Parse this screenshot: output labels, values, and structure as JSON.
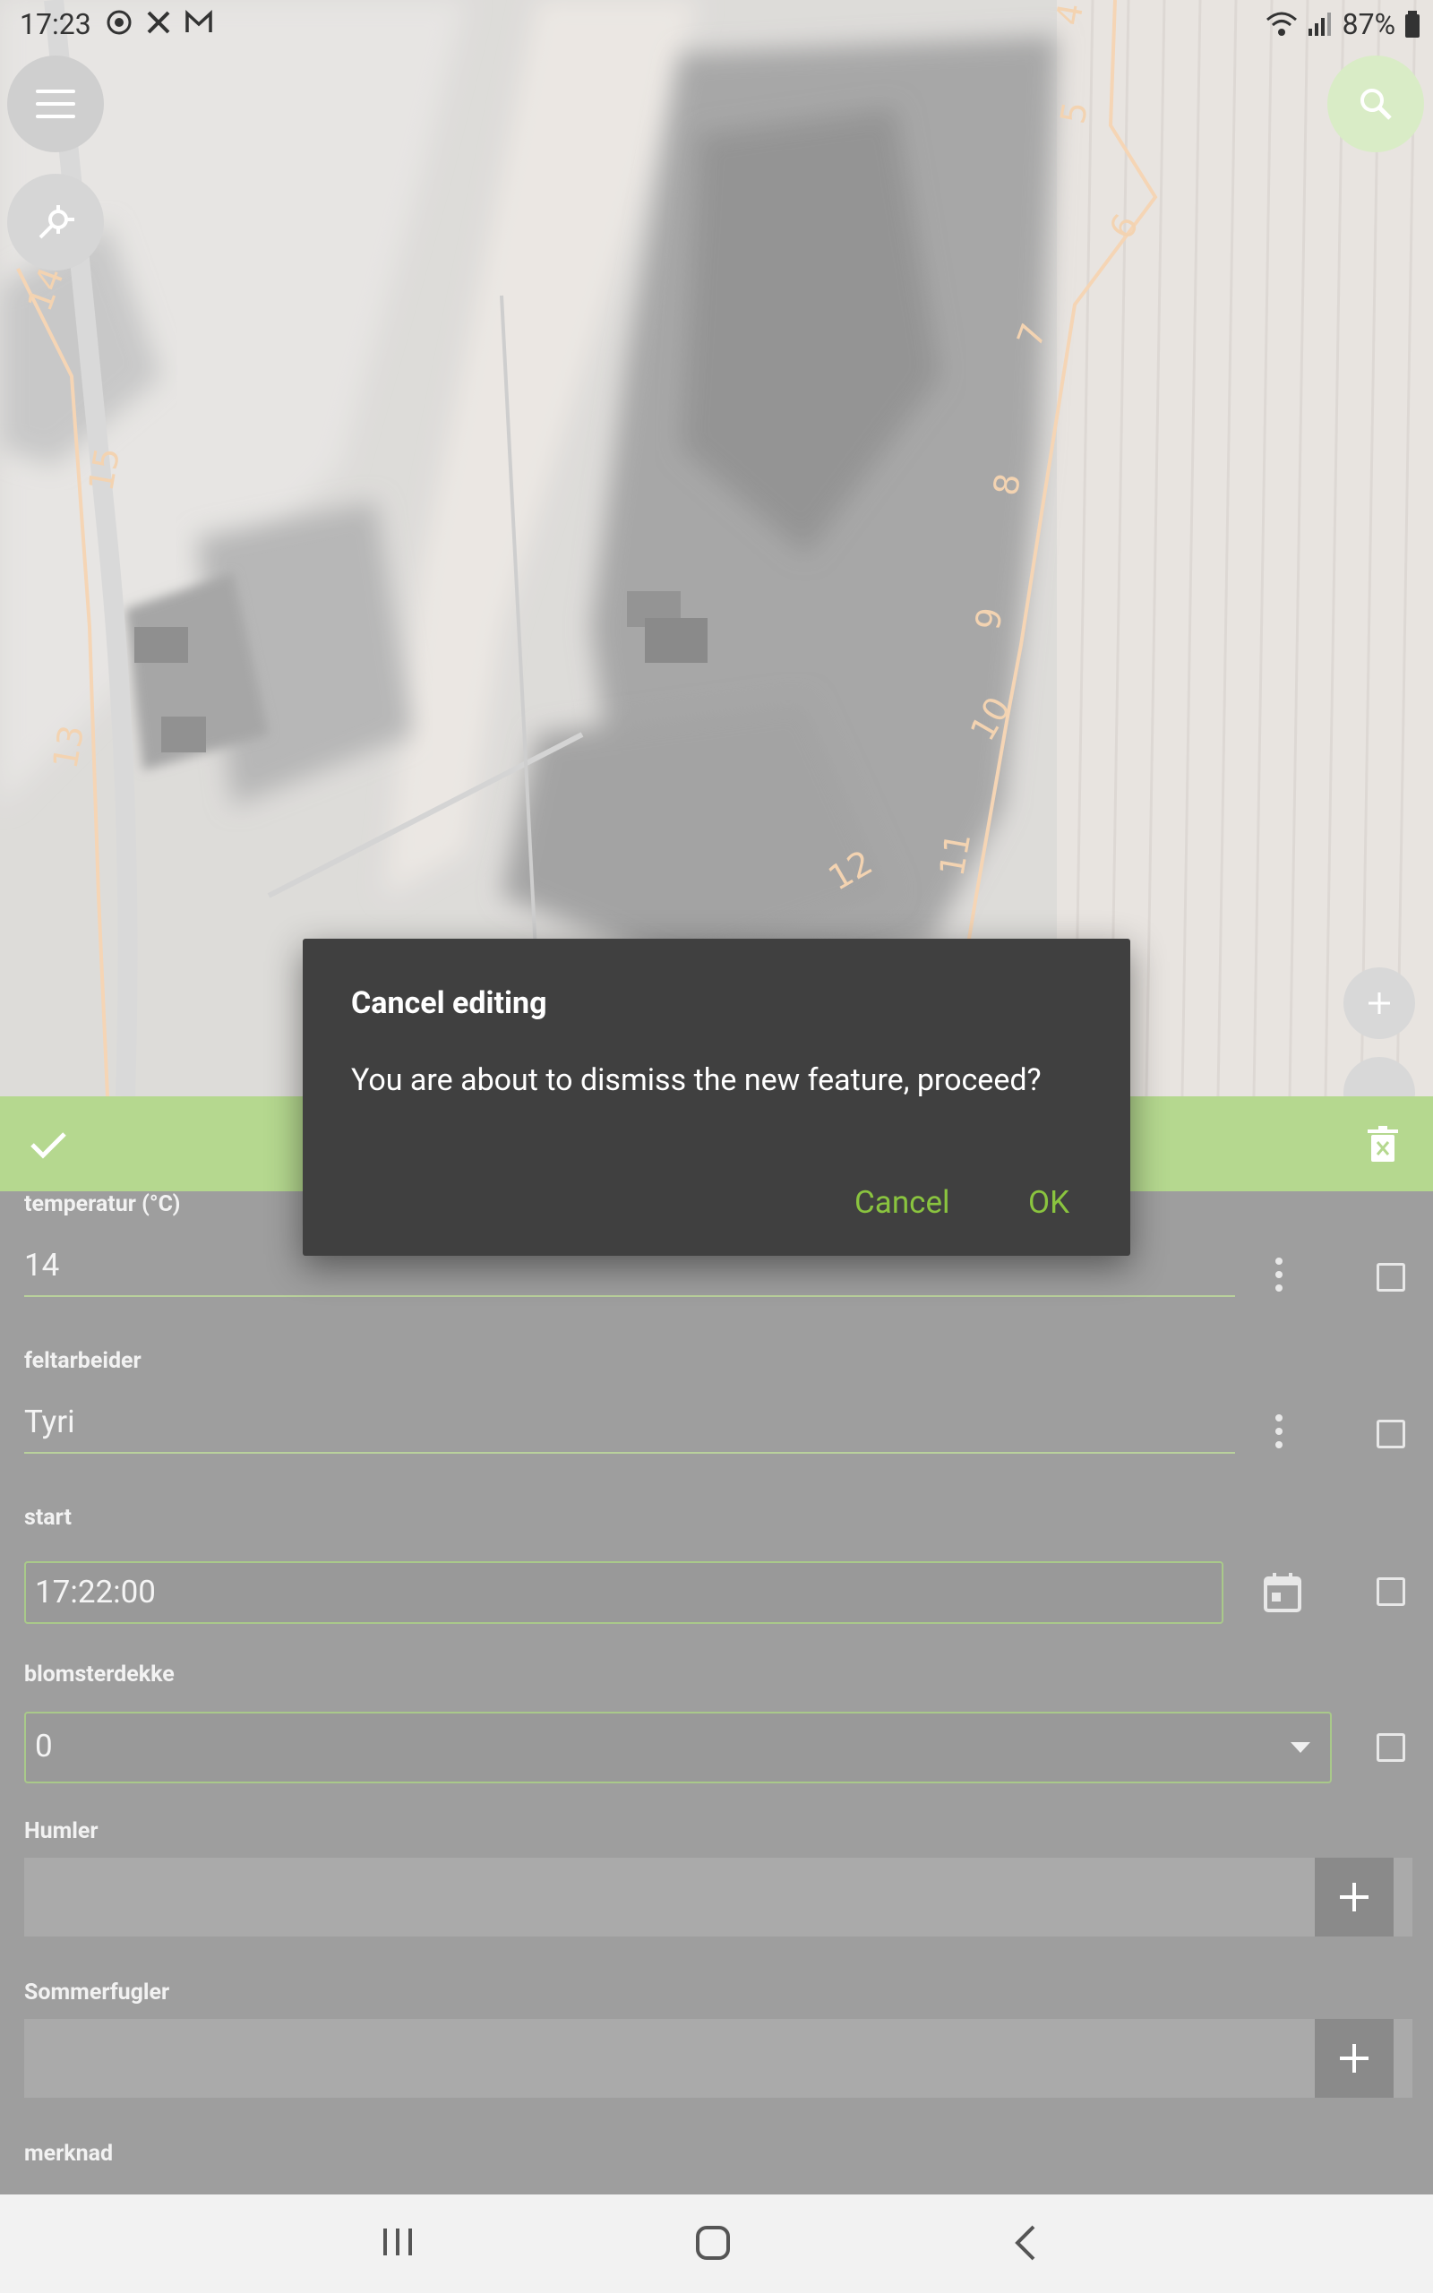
{
  "status_bar": {
    "time": "17:23",
    "battery": "87%"
  },
  "dialog": {
    "title": "Cancel editing",
    "message": "You are about to dismiss the new feature, proceed?",
    "cancel_label": "Cancel",
    "ok_label": "OK"
  },
  "map_labels": [
    "4",
    "5",
    "6",
    "7",
    "8",
    "9",
    "10",
    "11",
    "12",
    "13",
    "14",
    "15"
  ],
  "form": {
    "temperatur": {
      "label": "temperatur (°C)",
      "value": "14"
    },
    "feltarbeider": {
      "label": "feltarbeider",
      "value": "Tyri"
    },
    "start": {
      "label": "start",
      "value": "17:22:00"
    },
    "blomsterdekke": {
      "label": "blomsterdekke",
      "value": "0"
    },
    "humler": {
      "label": "Humler"
    },
    "sommerfugler": {
      "label": "Sommerfugler"
    },
    "merknad": {
      "label": "merknad"
    }
  },
  "colors": {
    "accent": "#8ac43f",
    "toolbar": "#b5d88f",
    "dialog_bg": "#404040"
  },
  "icons": [
    "menu-icon",
    "search-icon",
    "gps-icon",
    "zoom-in-icon",
    "save-check-icon",
    "delete-icon",
    "more-vert-icon",
    "calendar-icon",
    "dropdown-arrow-icon",
    "add-icon",
    "recents-icon",
    "home-icon",
    "back-icon"
  ]
}
